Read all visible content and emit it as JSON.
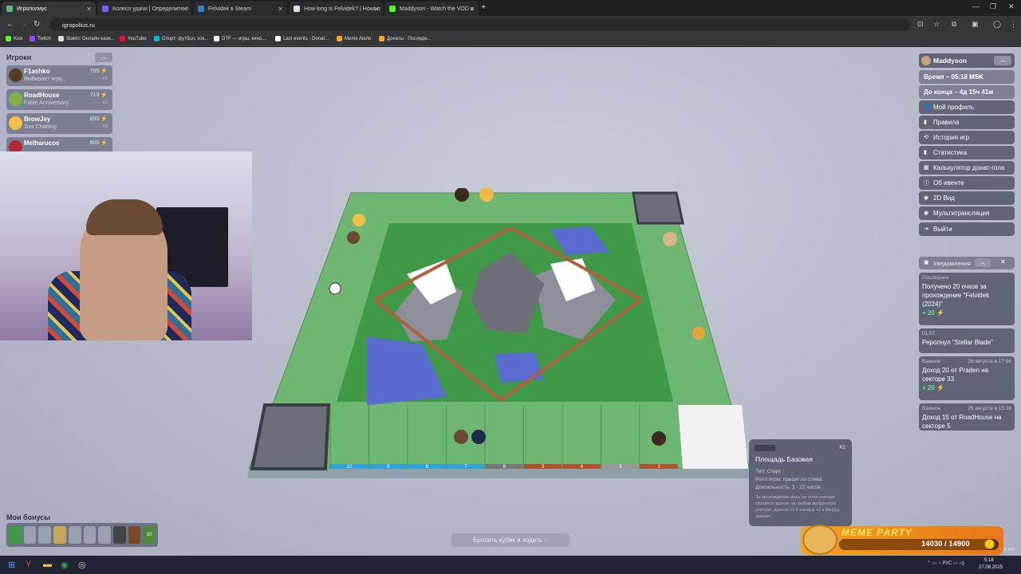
{
  "tabs": [
    {
      "label": "Игрополиус",
      "color": "#5bb974",
      "active": true
    },
    {
      "label": "Колесо удачи | Определите п",
      "color": "#7a5cff"
    },
    {
      "label": "Felvidek в Steam",
      "color": "#2a7fcf"
    },
    {
      "label": "How long is Felvidek? | HowLo",
      "color": "#e0e0e0"
    },
    {
      "label": "Maddyson - Watch the VOD o",
      "color": "#53fc18"
    }
  ],
  "url": "igropolius.ru",
  "bookmarks": [
    {
      "label": "Kick",
      "color": "#53fc18"
    },
    {
      "label": "Twitch",
      "color": "#9146ff"
    },
    {
      "label": "Stakin: Онлайн-кази...",
      "color": "#dddddd"
    },
    {
      "label": "YouTube",
      "color": "#ff0033"
    },
    {
      "label": "Спорт: футбол, хок...",
      "color": "#00b8d4"
    },
    {
      "label": "DTF — игры, кино,...",
      "color": "#ffffff"
    },
    {
      "label": "Last events - Donat...",
      "color": "#ffffff"
    },
    {
      "label": "Meme Alerts",
      "color": "#f5a623"
    },
    {
      "label": "Донаты - Последн...",
      "color": "#f5a623"
    }
  ],
  "players": {
    "title": "Игроки",
    "list": [
      {
        "name": "F1ashko",
        "sub": "Выбирает игру...",
        "score": "785 ⚡",
        "rank": "#1",
        "avatar": "#5a3a28"
      },
      {
        "name": "RoadHouse",
        "sub": "Fable Anniversary",
        "score": "713 ⚡",
        "rank": "#2",
        "avatar": "#7fb24a"
      },
      {
        "name": "BrowJey",
        "sub": "Just Chatting",
        "score": "690 ⚡",
        "rank": "#2",
        "avatar": "#f4c043"
      },
      {
        "name": "Melharucos",
        "sub": "",
        "score": "606 ⚡",
        "rank": "",
        "avatar": "#b22a3a"
      }
    ]
  },
  "bonuses": {
    "title": "Мои бонусы",
    "items": [
      "",
      "",
      "",
      "",
      "",
      "",
      "",
      "",
      "",
      "10"
    ]
  },
  "dice_button": "Бросить кубик и ходить ◌",
  "user": {
    "name": "Maddyson"
  },
  "info": {
    "time": "Время – 05:18 MSK",
    "remaining": "До конца – 4д 15ч 41м"
  },
  "menu": [
    {
      "icon": "person",
      "glyph": "👤",
      "label": "Мой профиль"
    },
    {
      "icon": "book",
      "glyph": "▮",
      "label": "Правила"
    },
    {
      "icon": "history",
      "glyph": "⟲",
      "label": "История игр"
    },
    {
      "icon": "chart",
      "glyph": "▮",
      "label": "Статистика"
    },
    {
      "icon": "calculator",
      "glyph": "▦",
      "label": "Калькулятор донат-гола"
    },
    {
      "icon": "info",
      "glyph": "ⓘ",
      "label": "Об ивенте"
    },
    {
      "icon": "eye",
      "glyph": "◉",
      "label": "2D Вид"
    },
    {
      "icon": "eye",
      "glyph": "◉",
      "label": "Мультитрансляция"
    },
    {
      "icon": "logout",
      "glyph": "⇥",
      "label": "Выйти"
    }
  ],
  "notifications": {
    "title": "Уведомления",
    "items": [
      {
        "kind": "Последнее",
        "time": "",
        "text": "Получено 20 очков за прохождение \"Felvidek (2024)\"",
        "points": "+ 20 ⚡"
      },
      {
        "kind": "01:57",
        "time": "",
        "text": "Реролнул \"Stellar Blade\"",
        "points": ""
      },
      {
        "kind": "Важное",
        "time": "26 августа в 17:56",
        "text": "Доход 20 от Praden на секторе 33",
        "points": "+ 20 ⚡"
      },
      {
        "kind": "Важное",
        "time": "26 августа в 15:38",
        "text": "Доход 15 от RoadHouse на секторе 5",
        "points": ""
      }
    ]
  },
  "tooltip": {
    "number": "#1",
    "title": "Площадь Базовая",
    "type": "Тип: Старт",
    "roll": "Ролл игры: пресет из стима",
    "duration": "Длительность: 3 - 22 часов",
    "description": "За прохождение игры на этом секторе строится здание на любом выбранном секторе, дается +1.5 очков и +1 к бонусу здания."
  },
  "board": {
    "bottom_numbers": [
      "10",
      "9",
      "8",
      "7",
      "6",
      "5",
      "4",
      "3",
      "2"
    ],
    "bottom_colors": [
      "#2fa3d8",
      "#2fa3d8",
      "#2fa3d8",
      "#2fa3d8",
      "#777777",
      "#b0502a",
      "#b0502a",
      "#999999",
      "#b0502a"
    ]
  },
  "meme_party": {
    "title": "MEME PARTY",
    "value": "14030 / 14900",
    "progress": 0.94
  },
  "taskbar": {
    "lang": "РУС",
    "time": "5:18",
    "date": "27.08.2025",
    "version": "0.190"
  }
}
